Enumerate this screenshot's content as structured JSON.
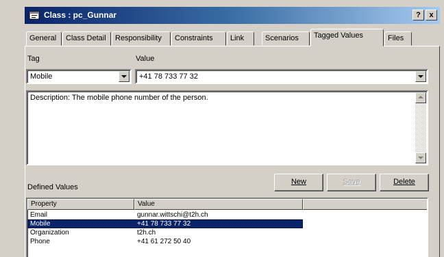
{
  "window": {
    "title": "Class : pc_Gunnar",
    "help_label": "?",
    "close_label": "x"
  },
  "tabs": [
    {
      "label": "General",
      "active": false
    },
    {
      "label": "Class Detail",
      "active": false
    },
    {
      "label": "Responsibility",
      "active": false
    },
    {
      "label": "Constraints",
      "active": false
    },
    {
      "label": "Link",
      "active": false
    },
    {
      "label": "Scenarios",
      "active": false
    },
    {
      "label": "Tagged Values",
      "active": true
    },
    {
      "label": "Files",
      "active": false
    }
  ],
  "form": {
    "tag_label": "Tag",
    "value_label": "Value",
    "tag_value": "Mobile",
    "value_value": "+41 78 733 77 32",
    "description": "Description: The mobile phone number of the person."
  },
  "buttons": {
    "new": "New",
    "save": "Save",
    "delete": "Delete"
  },
  "defined_values": {
    "label": "Defined Values",
    "columns": [
      "Property",
      "Value"
    ],
    "rows": [
      {
        "property": "Email",
        "value": "gunnar.wittschi@t2h.ch",
        "selected": false
      },
      {
        "property": "Mobile",
        "value": "+41 78 733 77 32",
        "selected": true
      },
      {
        "property": "Organization",
        "value": "t2h.ch",
        "selected": false
      },
      {
        "property": "Phone",
        "value": "+41 61 272 50 40",
        "selected": false
      }
    ]
  },
  "icons": {
    "title": "class-window-icon",
    "help": "help-icon",
    "close": "close-icon"
  },
  "colors": {
    "titlebar_start": "#0a246a",
    "titlebar_end": "#a6caf0",
    "face": "#d4d0c8",
    "selection": "#0a246a"
  }
}
